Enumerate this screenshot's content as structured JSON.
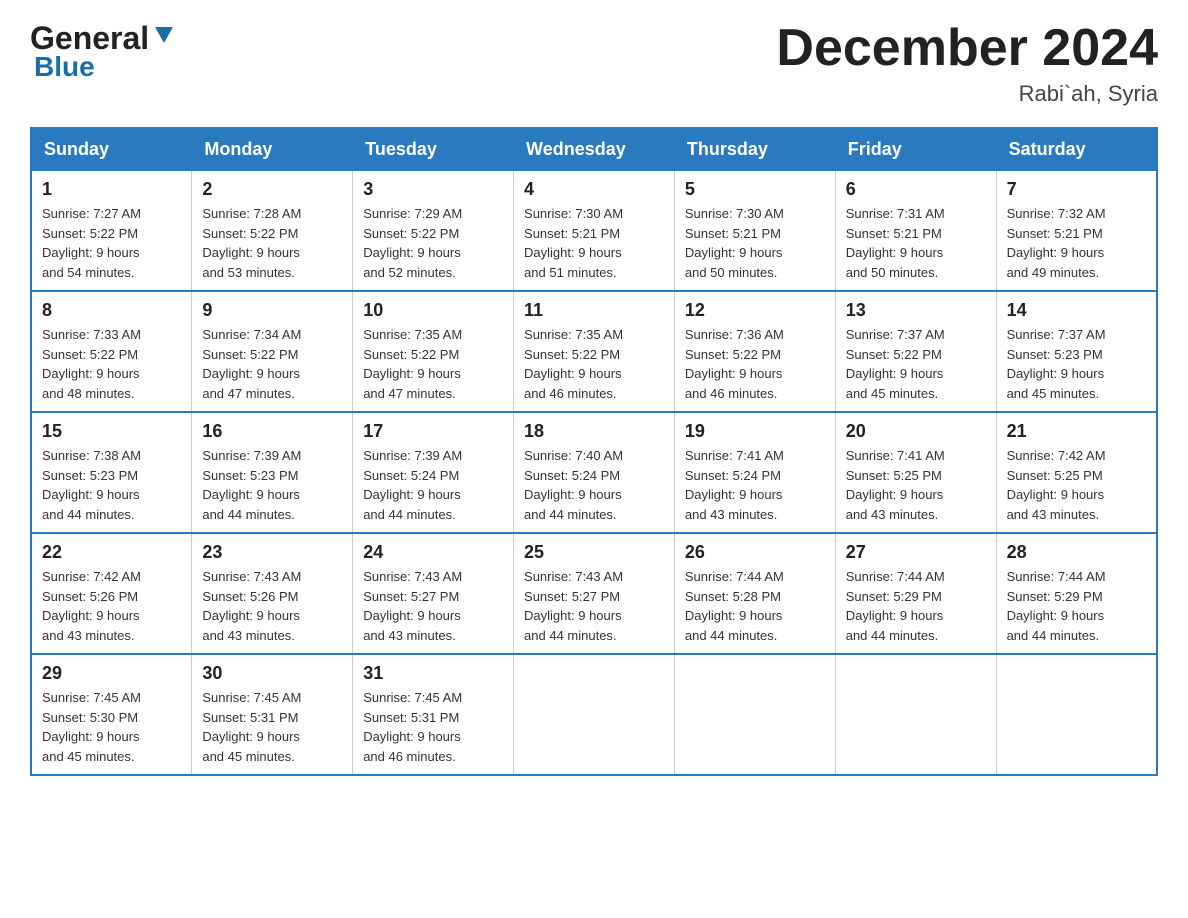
{
  "header": {
    "logo_general": "General",
    "logo_blue": "Blue",
    "main_title": "December 2024",
    "subtitle": "Rabi`ah, Syria"
  },
  "days_of_week": [
    "Sunday",
    "Monday",
    "Tuesday",
    "Wednesday",
    "Thursday",
    "Friday",
    "Saturday"
  ],
  "weeks": [
    [
      {
        "day": "1",
        "sunrise": "7:27 AM",
        "sunset": "5:22 PM",
        "daylight": "9 hours and 54 minutes."
      },
      {
        "day": "2",
        "sunrise": "7:28 AM",
        "sunset": "5:22 PM",
        "daylight": "9 hours and 53 minutes."
      },
      {
        "day": "3",
        "sunrise": "7:29 AM",
        "sunset": "5:22 PM",
        "daylight": "9 hours and 52 minutes."
      },
      {
        "day": "4",
        "sunrise": "7:30 AM",
        "sunset": "5:21 PM",
        "daylight": "9 hours and 51 minutes."
      },
      {
        "day": "5",
        "sunrise": "7:30 AM",
        "sunset": "5:21 PM",
        "daylight": "9 hours and 50 minutes."
      },
      {
        "day": "6",
        "sunrise": "7:31 AM",
        "sunset": "5:21 PM",
        "daylight": "9 hours and 50 minutes."
      },
      {
        "day": "7",
        "sunrise": "7:32 AM",
        "sunset": "5:21 PM",
        "daylight": "9 hours and 49 minutes."
      }
    ],
    [
      {
        "day": "8",
        "sunrise": "7:33 AM",
        "sunset": "5:22 PM",
        "daylight": "9 hours and 48 minutes."
      },
      {
        "day": "9",
        "sunrise": "7:34 AM",
        "sunset": "5:22 PM",
        "daylight": "9 hours and 47 minutes."
      },
      {
        "day": "10",
        "sunrise": "7:35 AM",
        "sunset": "5:22 PM",
        "daylight": "9 hours and 47 minutes."
      },
      {
        "day": "11",
        "sunrise": "7:35 AM",
        "sunset": "5:22 PM",
        "daylight": "9 hours and 46 minutes."
      },
      {
        "day": "12",
        "sunrise": "7:36 AM",
        "sunset": "5:22 PM",
        "daylight": "9 hours and 46 minutes."
      },
      {
        "day": "13",
        "sunrise": "7:37 AM",
        "sunset": "5:22 PM",
        "daylight": "9 hours and 45 minutes."
      },
      {
        "day": "14",
        "sunrise": "7:37 AM",
        "sunset": "5:23 PM",
        "daylight": "9 hours and 45 minutes."
      }
    ],
    [
      {
        "day": "15",
        "sunrise": "7:38 AM",
        "sunset": "5:23 PM",
        "daylight": "9 hours and 44 minutes."
      },
      {
        "day": "16",
        "sunrise": "7:39 AM",
        "sunset": "5:23 PM",
        "daylight": "9 hours and 44 minutes."
      },
      {
        "day": "17",
        "sunrise": "7:39 AM",
        "sunset": "5:24 PM",
        "daylight": "9 hours and 44 minutes."
      },
      {
        "day": "18",
        "sunrise": "7:40 AM",
        "sunset": "5:24 PM",
        "daylight": "9 hours and 44 minutes."
      },
      {
        "day": "19",
        "sunrise": "7:41 AM",
        "sunset": "5:24 PM",
        "daylight": "9 hours and 43 minutes."
      },
      {
        "day": "20",
        "sunrise": "7:41 AM",
        "sunset": "5:25 PM",
        "daylight": "9 hours and 43 minutes."
      },
      {
        "day": "21",
        "sunrise": "7:42 AM",
        "sunset": "5:25 PM",
        "daylight": "9 hours and 43 minutes."
      }
    ],
    [
      {
        "day": "22",
        "sunrise": "7:42 AM",
        "sunset": "5:26 PM",
        "daylight": "9 hours and 43 minutes."
      },
      {
        "day": "23",
        "sunrise": "7:43 AM",
        "sunset": "5:26 PM",
        "daylight": "9 hours and 43 minutes."
      },
      {
        "day": "24",
        "sunrise": "7:43 AM",
        "sunset": "5:27 PM",
        "daylight": "9 hours and 43 minutes."
      },
      {
        "day": "25",
        "sunrise": "7:43 AM",
        "sunset": "5:27 PM",
        "daylight": "9 hours and 44 minutes."
      },
      {
        "day": "26",
        "sunrise": "7:44 AM",
        "sunset": "5:28 PM",
        "daylight": "9 hours and 44 minutes."
      },
      {
        "day": "27",
        "sunrise": "7:44 AM",
        "sunset": "5:29 PM",
        "daylight": "9 hours and 44 minutes."
      },
      {
        "day": "28",
        "sunrise": "7:44 AM",
        "sunset": "5:29 PM",
        "daylight": "9 hours and 44 minutes."
      }
    ],
    [
      {
        "day": "29",
        "sunrise": "7:45 AM",
        "sunset": "5:30 PM",
        "daylight": "9 hours and 45 minutes."
      },
      {
        "day": "30",
        "sunrise": "7:45 AM",
        "sunset": "5:31 PM",
        "daylight": "9 hours and 45 minutes."
      },
      {
        "day": "31",
        "sunrise": "7:45 AM",
        "sunset": "5:31 PM",
        "daylight": "9 hours and 46 minutes."
      },
      null,
      null,
      null,
      null
    ]
  ],
  "labels": {
    "sunrise": "Sunrise:",
    "sunset": "Sunset:",
    "daylight": "Daylight:"
  }
}
